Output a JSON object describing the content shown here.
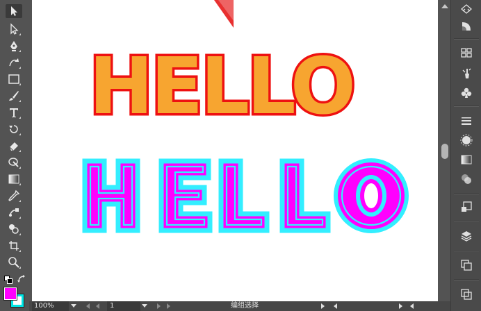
{
  "tools": [
    {
      "name": "selection-tool-icon"
    },
    {
      "name": "direct-selection-tool-icon"
    },
    {
      "name": "pen-tool-icon"
    },
    {
      "name": "curvature-tool-icon"
    },
    {
      "name": "rectangle-tool-icon"
    },
    {
      "name": "paintbrush-tool-icon"
    },
    {
      "name": "type-tool-icon"
    },
    {
      "name": "rotate-tool-icon"
    },
    {
      "name": "eraser-tool-icon"
    },
    {
      "name": "warp-tool-icon"
    },
    {
      "name": "gradient-tool-icon"
    },
    {
      "name": "eyedropper-tool-icon"
    },
    {
      "name": "blend-tool-icon"
    },
    {
      "name": "shape-builder-tool-icon"
    },
    {
      "name": "artboard-tool-icon"
    },
    {
      "name": "zoom-tool-icon"
    }
  ],
  "colors": {
    "fill": "#ff00ff",
    "stroke": "#00e5e5",
    "hello1_fill": "#f7a530",
    "hello1_stroke": "#ee1111",
    "hello2_fill": "#ff00ff",
    "hello2_inner": "#33eeff",
    "hello2_outer": "#33eeff"
  },
  "artboard": {
    "hello_top": "HELLO",
    "hello_bottom_letters": [
      "H",
      "E",
      "L",
      "L"
    ],
    "hello_bottom_last": "O"
  },
  "right_panel": [
    {
      "name": "color-guide-icon"
    },
    {
      "name": "color-icon"
    },
    {
      "name": "swatches-icon"
    },
    {
      "name": "brushes-icon"
    },
    {
      "name": "symbols-icon"
    },
    {
      "name": "stroke-icon"
    },
    {
      "name": "appearance-icon"
    },
    {
      "name": "gradient-icon"
    },
    {
      "name": "transparency-icon"
    },
    {
      "name": "asset-export-icon"
    },
    {
      "name": "layers-icon"
    },
    {
      "name": "artboards-icon"
    },
    {
      "name": "libraries-icon"
    }
  ],
  "status": {
    "zoom": "100%",
    "page": "1",
    "selection_text": "编组选择"
  }
}
